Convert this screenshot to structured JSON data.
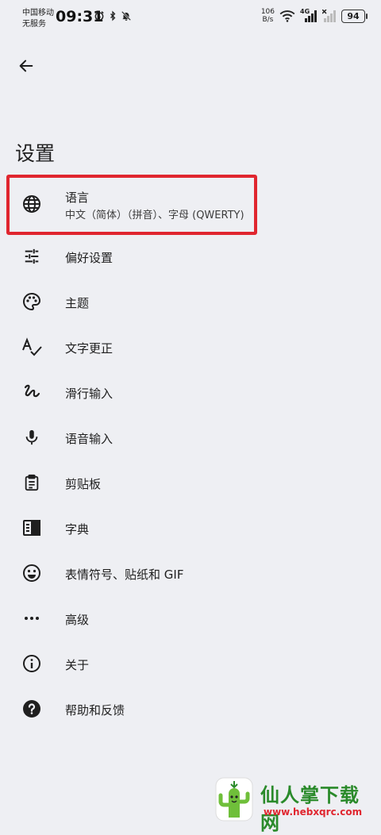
{
  "status_bar": {
    "carrier_line1": "中国移动",
    "carrier_line2": "无服务",
    "time": "09:31",
    "net_speed_value": "106",
    "net_speed_unit": "B/s",
    "signal_label": "4G",
    "battery": "94"
  },
  "page": {
    "title": "设置"
  },
  "settings": [
    {
      "name": "language",
      "icon": "globe-icon",
      "label": "语言",
      "sublabel": "中文（简体）（拼音）、字母 (QWERTY)"
    },
    {
      "name": "preferences",
      "icon": "tune-icon",
      "label": "偏好设置"
    },
    {
      "name": "theme",
      "icon": "palette-icon",
      "label": "主题"
    },
    {
      "name": "text-correction",
      "icon": "spellcheck-icon",
      "label": "文字更正"
    },
    {
      "name": "glide-typing",
      "icon": "gesture-icon",
      "label": "滑行输入"
    },
    {
      "name": "voice-input",
      "icon": "microphone-icon",
      "label": "语音输入"
    },
    {
      "name": "clipboard",
      "icon": "clipboard-icon",
      "label": "剪贴板"
    },
    {
      "name": "dictionary",
      "icon": "dictionary-icon",
      "label": "字典"
    },
    {
      "name": "emoji",
      "icon": "emoji-icon",
      "label": "表情符号、贴纸和 GIF"
    },
    {
      "name": "advanced",
      "icon": "more-horizontal-icon",
      "label": "高级"
    },
    {
      "name": "about",
      "icon": "info-icon",
      "label": "关于"
    },
    {
      "name": "help",
      "icon": "help-icon",
      "label": "帮助和反馈"
    }
  ],
  "watermark": {
    "text": "仙人掌下载网",
    "url": "www.hebxqrc.com"
  },
  "colors": {
    "background": "#eeeff3",
    "highlight": "#e0262f"
  }
}
